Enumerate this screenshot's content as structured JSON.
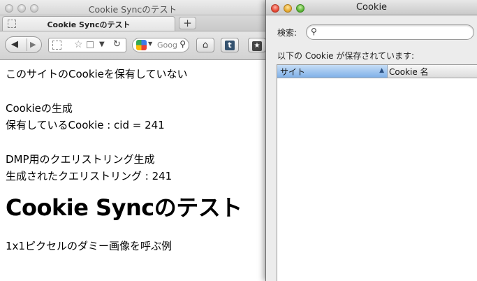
{
  "browser": {
    "window_title": "Cookie Syncのテスト",
    "tab_label": "Cookie Syncのテスト",
    "new_tab_label": "+",
    "search_text": "Goog",
    "content": {
      "line1": "このサイトのCookieを保有していない",
      "line2": "Cookieの生成",
      "line3": "保有しているCookie : cid = 241",
      "line4": "DMP用のクエリストリング生成",
      "line5": "生成されたクエリストリング : 241",
      "heading": "Cookie Syncのテスト",
      "line6": "1x1ピクセルのダミー画像を呼ぶ例"
    }
  },
  "cookie_window": {
    "title": "Cookie",
    "search_label": "検索:",
    "search_value": "",
    "info_text": "以下の Cookie が保存されています:",
    "columns": [
      "サイト",
      "Cookie 名"
    ],
    "rows": []
  },
  "icons": {
    "back": "back-arrow-icon",
    "forward": "forward-arrow-icon",
    "reload": "reload-icon",
    "home": "home-icon",
    "tumblr": "tumblr-icon",
    "bookmark": "bookmark-star-icon",
    "search": "magnifier-icon"
  },
  "colors": {
    "selected_header": "#7fb0e8",
    "close_red": "#e4432f",
    "minimize_yellow": "#e5a62b",
    "zoom_green": "#55b032"
  }
}
